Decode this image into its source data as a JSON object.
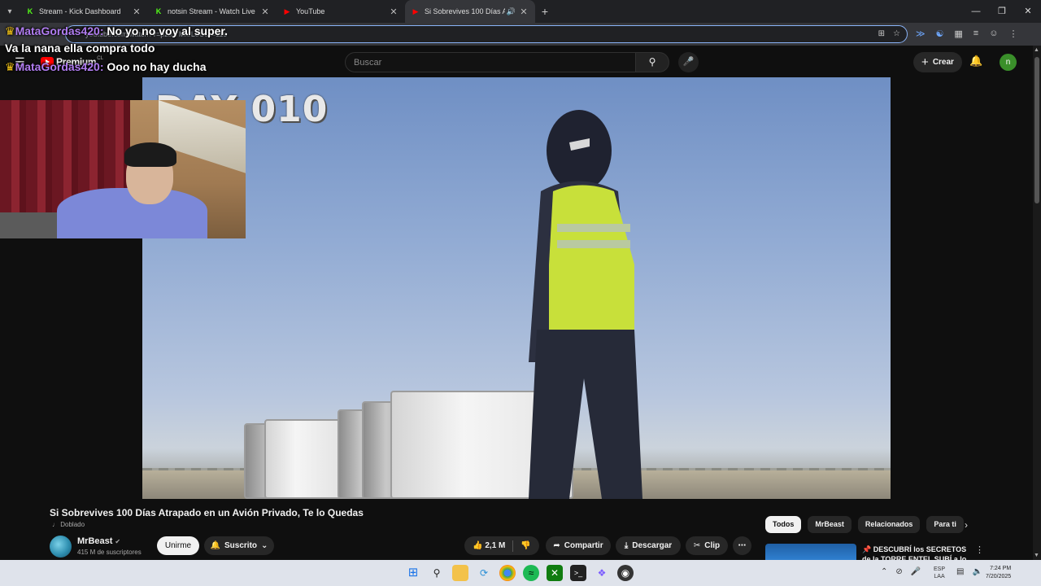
{
  "browser": {
    "tabs": [
      {
        "title": "Stream - Kick Dashboard",
        "favicon": "kick-icon",
        "favicon_color": "#53fc18"
      },
      {
        "title": "notsin Stream - Watch Live on Kick",
        "favicon": "kick-icon",
        "favicon_color": "#53fc18"
      },
      {
        "title": "YouTube",
        "favicon": "youtube-icon",
        "favicon_color": "#ff0000"
      },
      {
        "title": "Si Sobrevives 100 Días Atrap",
        "favicon": "youtube-icon",
        "favicon_color": "#ff0000",
        "active": true
      }
    ],
    "url": "youtube.com/watch?v=pzalYMxrLoU&t=11s"
  },
  "chat_overlay": {
    "messages": [
      {
        "user": "MataGordas420:",
        "text": "No yo no voy al super. Va la nana ella compra todo"
      },
      {
        "user": "MataGordas420:",
        "text": "Ooo no hay ducha"
      }
    ]
  },
  "youtube": {
    "logo_word": "Premium",
    "logo_country": "CL",
    "search_placeholder": "Buscar",
    "create_label": "Crear",
    "avatar_letter": "n",
    "accent_color": "#ff0000"
  },
  "video": {
    "overlay_label": "DAY 010",
    "title": "Si Sobrevives 100 Días Atrapado en un Avión Privado, Te lo Quedas",
    "dubbed_label": "Doblado",
    "channel_name": "MrBeast",
    "subscribers": "415 M de suscriptores",
    "join_label": "Unirme",
    "subscribed_label": "Suscrito",
    "likes": "2,1 M",
    "share_label": "Compartir",
    "download_label": "Descargar",
    "clip_label": "Clip"
  },
  "chips": [
    "Todos",
    "MrBeast",
    "Relacionados",
    "Para ti"
  ],
  "recommendation": {
    "title": "DESCUBRÍ los SECRETOS de la TORRE ENTEL SUBÍ a lo"
  },
  "taskbar": {
    "language": "ESP",
    "layout": "LAA",
    "time": "7:24 PM",
    "date": "7/20/2025"
  }
}
